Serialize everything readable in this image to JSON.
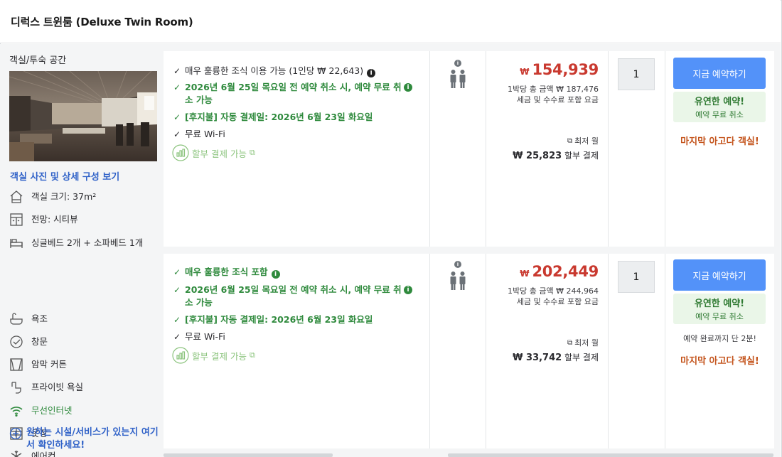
{
  "room_title": "디럭스 트윈룸 (Deluxe Twin Room)",
  "left": {
    "section_label": "객실/투숙 공간",
    "photo_link": "객실 사진 및 상세 구성 보기",
    "amenities": [
      {
        "icon": "house-icon",
        "label": "객실 크기: 37m²"
      },
      {
        "icon": "window-view-icon",
        "label": "전망: 시티뷰"
      },
      {
        "icon": "bed-icon",
        "label": "싱글베드 2개 + 소파베드 1개"
      },
      {
        "icon": "bathtub-icon",
        "label": "욕조"
      },
      {
        "icon": "window-icon",
        "label": "창문"
      },
      {
        "icon": "curtain-icon",
        "label": "암막 커튼"
      },
      {
        "icon": "shower-icon",
        "label": "프라이빗 욕실"
      },
      {
        "icon": "wifi-icon",
        "label": "무선인터넷"
      },
      {
        "icon": "wardrobe-icon",
        "label": "옷장"
      },
      {
        "icon": "snowflake-icon",
        "label": "에어컨"
      }
    ],
    "facility_link": "원하는 시설/서비스가 있는지 여기서 확인하세요!"
  },
  "offers": [
    {
      "benefits": [
        {
          "style": "dark",
          "text": "매우 훌륭한 조식 이용 가능 (1인당 ₩ 22,643)",
          "info": true
        },
        {
          "style": "green",
          "text": "2026년 6월 25일 목요일 전 예약 취소 시, 예약 무료 취소 가능",
          "info": true
        },
        {
          "style": "green",
          "text": "[후지불] 자동 결제일: 2026년 6월 23일 화요일",
          "info": false
        },
        {
          "style": "dark",
          "text": "무료 Wi-Fi",
          "info": false
        }
      ],
      "installment": "할부 결제 가능",
      "price_currency": "₩",
      "price": "154,939",
      "total_line": "1박당 총 금액 ₩ 187,476",
      "tax_line": "세금 및 수수료 포함 요금",
      "lowest_label": "최저 월",
      "monthly_amount": "₩ 25,823",
      "monthly_suffix": "할부 결제",
      "quantity": "1",
      "book_label": "지금 예약하기",
      "flex_title": "유연한 예약!",
      "flex_sub": "예약 무료 취소",
      "urgency": "",
      "last_chance": "마지막 아고다 객실!"
    },
    {
      "benefits": [
        {
          "style": "green",
          "text": "매우 훌륭한 조식 포함",
          "info": true
        },
        {
          "style": "green",
          "text": "2026년 6월 25일 목요일 전 예약 취소 시, 예약 무료 취소 가능",
          "info": true
        },
        {
          "style": "green",
          "text": "[후지불] 자동 결제일: 2026년 6월 23일 화요일",
          "info": false
        },
        {
          "style": "dark",
          "text": "무료 Wi-Fi",
          "info": false
        }
      ],
      "installment": "할부 결제 가능",
      "price_currency": "₩",
      "price": "202,449",
      "total_line": "1박당 총 금액 ₩ 244,964",
      "tax_line": "세금 및 수수료 포함 요금",
      "lowest_label": "최저 월",
      "monthly_amount": "₩ 33,742",
      "monthly_suffix": "할부 결제",
      "quantity": "1",
      "book_label": "지금 예약하기",
      "flex_title": "유연한 예약!",
      "flex_sub": "예약 무료 취소",
      "urgency": "예약 완료까지 단 2분!",
      "last_chance": "마지막 아고다 객실!"
    }
  ],
  "icons": {
    "info_glyph": "i",
    "check_glyph": "✓",
    "external_glyph": "⧉",
    "plus_glyph": "+"
  },
  "colors": {
    "price_red": "#c9392f",
    "book_blue": "#5392f9",
    "green": "#2f8a3d",
    "link_blue": "#3062c8",
    "last_chance_orange": "#c4541c"
  }
}
